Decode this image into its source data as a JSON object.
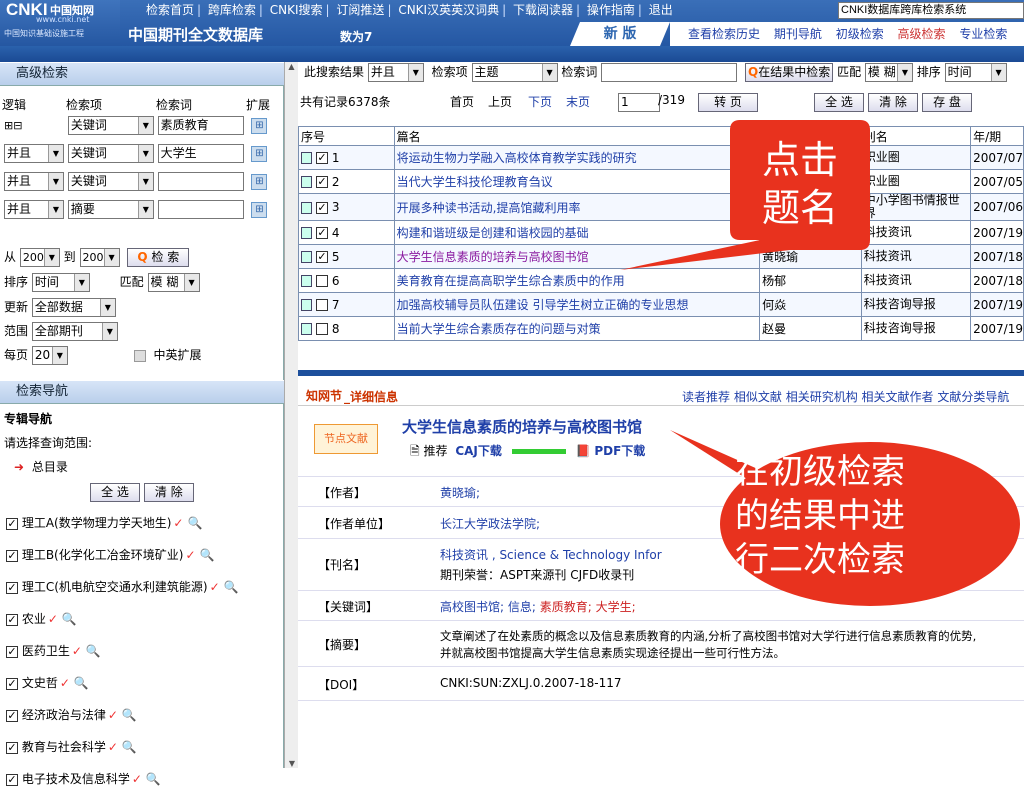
{
  "top": {
    "logo_main": "CNKI",
    "logo_cn": "中国知网",
    "logo_url": "www.cnki.net",
    "logo_sub": "中国知识基础设施工程",
    "nav": [
      "检索首页",
      "跨库检索",
      "CNKI搜索",
      "订阅推送",
      "CNKI汉英英汉词典",
      "下载阅读器",
      "操作指南",
      "退出"
    ],
    "system_select": "CNKI数据库跨库检索系统",
    "db_title": "中国期刊全文数据库",
    "count_label": "数为7",
    "new_tab": "新 版",
    "subnav": [
      "查看检索历史",
      "期刊导航",
      "初级检索",
      "高级检索",
      "专业检索"
    ]
  },
  "left": {
    "adv_search_title": "高级检索",
    "col_headers": {
      "logic": "逻辑",
      "item": "检索项",
      "word": "检索词",
      "expand": "扩展"
    },
    "plusminus": "⊞⊟",
    "rows": [
      {
        "logic": "",
        "item": "关键词",
        "word": "素质教育"
      },
      {
        "logic": "并且",
        "item": "关键词",
        "word": "大学生"
      },
      {
        "logic": "并且",
        "item": "关键词",
        "word": ""
      },
      {
        "logic": "并且",
        "item": "摘要",
        "word": ""
      }
    ],
    "from_label": "从",
    "from_year": "2005",
    "to_label": "到",
    "to_year": "2007",
    "search_button": "检 索",
    "sort_label": "排序",
    "sort_value": "时间",
    "match_label": "匹配",
    "match_value": "模 糊",
    "update_label": "更新",
    "update_value": "全部数据",
    "range_label": "范围",
    "range_value": "全部期刊",
    "perpage_label": "每页",
    "perpage_value": "20",
    "cn_en_expand": "中英扩展",
    "nav_title": "检索导航",
    "special_nav": "专辑导航",
    "choose_range": "请选择查询范围:",
    "all_catalog": "总目录",
    "select_all": "全 选",
    "clear": "清 除",
    "categories": [
      "理工A(数学物理力学天地生)",
      "理工B(化学化工冶金环境矿业)",
      "理工C(机电航空交通水利建筑能源)",
      "农业",
      "医药卫生",
      "文史哲",
      "经济政治与法律",
      "教育与社会科学",
      "电子技术及信息科学"
    ]
  },
  "right": {
    "in_results_label": "此搜索结果",
    "logic_value": "并且",
    "item_label": "检索项",
    "item_value": "主题",
    "word_label": "检索词",
    "word_value": "",
    "in_result_search": "在结果中检索",
    "match_label": "匹配",
    "match_value": "模 糊",
    "sort_label": "排序",
    "sort_value": "时间",
    "total": "共有记录6378条",
    "first": "首页",
    "prev": "上页",
    "next": "下页",
    "last": "末页",
    "page_input": "1",
    "page_total": "/319",
    "goto": "转 页",
    "select_all": "全 选",
    "clear": "清 除",
    "save": "存 盘",
    "headers": {
      "no": "序号",
      "title": "篇名",
      "author": "作者",
      "journal": "刊名",
      "issue": "年/期"
    },
    "rows": [
      {
        "no": "1",
        "title": "将运动生物力学融入高校体育教学实践的研究",
        "author": "",
        "journal": "职业圈",
        "issue": "2007/07",
        "checked": true
      },
      {
        "no": "2",
        "title": "当代大学生科技伦理教育刍议",
        "author": "",
        "journal": "职业圈",
        "issue": "2007/05",
        "checked": true
      },
      {
        "no": "3",
        "title": "开展多种读书活动,提高馆藏利用率",
        "author": "",
        "journal": "中小学图书情报世界",
        "issue": "2007/06",
        "checked": true
      },
      {
        "no": "4",
        "title": "构建和谐班级是创建和谐校园的基础",
        "author": "吴在芳",
        "journal": "科技资讯",
        "issue": "2007/19",
        "checked": true
      },
      {
        "no": "5",
        "title": "大学生信息素质的培养与高校图书馆",
        "author": "黄晓瑜",
        "journal": "科技资讯",
        "issue": "2007/18",
        "checked": true
      },
      {
        "no": "6",
        "title": "美育教育在提高高职学生综合素质中的作用",
        "author": "杨郁",
        "journal": "科技资讯",
        "issue": "2007/18",
        "checked": false
      },
      {
        "no": "7",
        "title": "加强高校辅导员队伍建设 引导学生树立正确的专业思想",
        "author": "何焱",
        "journal": "科技咨询导报",
        "issue": "2007/19",
        "checked": false
      },
      {
        "no": "8",
        "title": "当前大学生综合素质存在的问题与对策",
        "author": "赵曼",
        "journal": "科技咨询导报",
        "issue": "2007/19",
        "checked": false
      }
    ],
    "detail": {
      "header": "_详细信息",
      "links": [
        "读者推荐",
        "相似文献",
        "相关研究机构",
        "相关文献作者",
        "文献分类导航"
      ],
      "badge": "节点文献",
      "title": "大学生信息素质的培养与高校图书馆",
      "recommend": "推荐",
      "caj": "CAJ下载",
      "pdf": "PDF下载",
      "fields": [
        {
          "label": "【作者】",
          "value": "黄晓瑜;"
        },
        {
          "label": "【作者单位】",
          "value": "长江大学政法学院;"
        },
        {
          "label": "【刊名】",
          "value": "科技资讯 , Science & Technology Infor",
          "extra": "期刊荣誉：ASPT来源刊  CJFD收录刊"
        },
        {
          "label": "【关键词】",
          "value": "高校图书馆; 信息; ",
          "value_red": "素质教育; 大学生;"
        },
        {
          "label": "【摘要】",
          "value": "文章阐述了在处素质的概念以及信息素质教育的内涵,分析了高校图书馆对大学行进行信息素质教育的优势,",
          "extra": "并就高校图书馆提高大学生信息素质实现途径提出一些可行性方法。"
        },
        {
          "label": "【DOI】",
          "value": "CNKI:SUN:ZXLJ.0.2007-18-117"
        }
      ]
    }
  },
  "callouts": {
    "click_title": [
      "点击",
      "题名"
    ],
    "secondary_search": [
      "在初级检索",
      "的结果中进",
      "行二次检索"
    ]
  },
  "colors": {
    "topbar": "#1d4f9c",
    "callout": "#e8321e",
    "link": "#1f3fa8"
  }
}
